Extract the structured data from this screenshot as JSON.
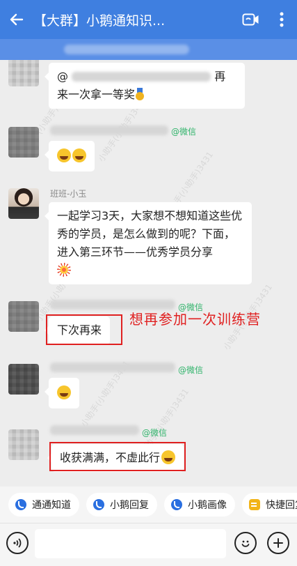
{
  "header": {
    "title": "【大群】小鹅通知识...",
    "back_icon": "arrow-left-icon",
    "video_icon": "video-call-icon",
    "more_icon": "more-vertical-icon",
    "color": "#3f7fe0"
  },
  "messages": [
    {
      "text_line1": "@",
      "text_suffix": "再",
      "text_line2": "来一次拿一等奖"
    },
    {
      "wechat_tag": "@微信"
    },
    {
      "sender": "班班-小玉",
      "text": "一起学习3天，大家想不想知道这些优秀的学员，是怎么做到的呢？下面，进入第三环节——优秀学员分享"
    },
    {
      "wechat_tag": "@微信",
      "text": "下次再来"
    },
    {
      "wechat_tag": "@微信"
    },
    {
      "wechat_tag": "@微信",
      "text": "收获满满，不虚此行"
    }
  ],
  "annotation": {
    "text": "想再参加一次训练营",
    "color": "#e02020"
  },
  "watermark": "小助手(小助手)3431",
  "quick_replies": [
    {
      "label": "通通知道",
      "icon": "bot-icon"
    },
    {
      "label": "小鹅回复",
      "icon": "bot-icon"
    },
    {
      "label": "小鹅画像",
      "icon": "bot-icon"
    },
    {
      "label": "快捷回复",
      "icon": "quick-reply-icon"
    }
  ],
  "input": {
    "voice_icon": "voice-icon",
    "emoji_icon": "emoji-icon",
    "add_icon": "add-icon"
  }
}
